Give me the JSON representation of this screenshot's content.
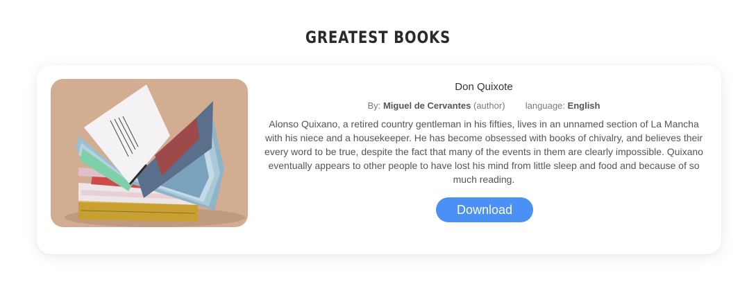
{
  "section": {
    "title": "GREATEST BOOKS"
  },
  "book": {
    "title": "Don Quixote",
    "by_label": "By:",
    "author": "Miguel de Cervantes",
    "author_role": "(author)",
    "language_label": "language:",
    "language": "English",
    "description": "Alonso Quixano, a retired country gentleman in his fifties, lives in an unnamed section of La Mancha with his niece and a housekeeper. He has become obsessed with books of chivalry, and believes their every word to be true, despite the fact that many of the events in them are clearly impossible. Quixano eventually appears to other people to have lost his mind from little sleep and food and because of so much reading.",
    "download_label": "Download",
    "cover_image": "open-book-photo"
  },
  "colors": {
    "accent": "#4a90f5",
    "background": "#ffffff",
    "title_text": "#2a2a2a"
  }
}
